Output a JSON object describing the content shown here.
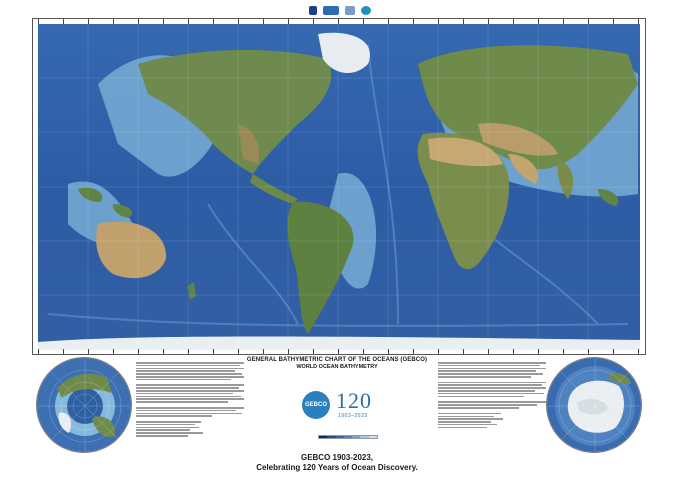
{
  "logos": [
    "iho-logo",
    "ioc-unesco-logo",
    "nippon-foundation-logo",
    "gebco-seabed-logo"
  ],
  "map": {
    "colors": {
      "deep_ocean": "#2b5aa3",
      "mid_ocean": "#3f74b8",
      "shelf": "#7fb6d9",
      "land_green": "#6f8a4a",
      "land_desert": "#b89a6a",
      "ice": "#e8eef2"
    }
  },
  "titles": {
    "main": "GENERAL BATHYMETRIC CHART OF THE OCEANS (GEBCO)",
    "sub": "WORLD OCEAN BATHYMETRY"
  },
  "emblem": {
    "gebco": "GEBCO",
    "number": "120",
    "years": "1903–2023"
  },
  "legend_colors": [
    "#0d2b63",
    "#1f4c8f",
    "#2f66aa",
    "#4a86c2",
    "#6fa7d6",
    "#9cc8e6",
    "#c9e3f2"
  ],
  "footer": {
    "line1": "GEBCO 1903-2023,",
    "line2": "Celebrating 120 Years of Ocean Discovery."
  }
}
